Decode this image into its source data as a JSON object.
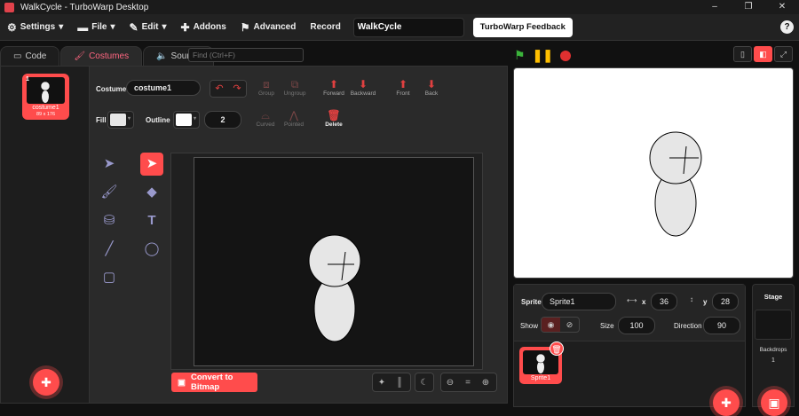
{
  "window": {
    "title": "WalkCycle - TurboWarp Desktop",
    "controls": [
      "–",
      "❐",
      "✕"
    ]
  },
  "menubar": {
    "settings": "Settings",
    "file": "File",
    "edit": "Edit",
    "addons": "Addons",
    "advanced": "Advanced",
    "record": "Record",
    "project_title": "WalkCycle",
    "feedback": "TurboWarp Feedback",
    "help": "?"
  },
  "tabs": {
    "code": "Code",
    "costumes": "Costumes",
    "sounds": "Sounds",
    "active": "costumes"
  },
  "find": {
    "placeholder": "Find (Ctrl+F)"
  },
  "costume_list": [
    {
      "index": "1",
      "name": "costume1",
      "size": "89 x 176"
    }
  ],
  "paint": {
    "costume_label": "Costume",
    "costume_name": "costume1",
    "fill_label": "Fill",
    "fill_color": "#e6e6e6",
    "outline_label": "Outline",
    "outline_color": "#ffffff",
    "outline_size": "2",
    "group": "Group",
    "ungroup": "Ungroup",
    "forward": "Forward",
    "backward": "Backward",
    "front": "Front",
    "back": "Back",
    "curved": "Curved",
    "pointed": "Pointed",
    "delete": "Delete",
    "convert": "Convert to Bitmap",
    "zoom_reset": "="
  },
  "sprite": {
    "sprite_label": "Sprite",
    "name": "Sprite1",
    "x_label": "x",
    "x": "36",
    "y_label": "y",
    "y": "28",
    "show_label": "Show",
    "size_label": "Size",
    "size": "100",
    "direction_label": "Direction",
    "direction": "90"
  },
  "sprites": [
    {
      "name": "Sprite1"
    }
  ],
  "stage_panel": {
    "title": "Stage",
    "backdrops_label": "Backdrops",
    "backdrops_count": "1"
  },
  "colors": {
    "accent": "#ff4c4c",
    "green_flag": "#3bb33b",
    "pause": "#ffbf00",
    "stop": "#e03030"
  }
}
